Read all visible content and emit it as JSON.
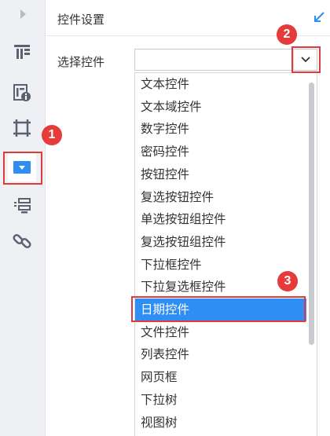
{
  "panel": {
    "title": "控件设置"
  },
  "field": {
    "label": "选择控件",
    "value": ""
  },
  "dropdown": {
    "options": [
      "文本控件",
      "文本域控件",
      "数字控件",
      "密码控件",
      "按钮控件",
      "复选按钮控件",
      "单选按钮组控件",
      "复选按钮组控件",
      "下拉框控件",
      "下拉复选框控件",
      "日期控件",
      "文件控件",
      "列表控件",
      "网页框",
      "下拉树",
      "视图树"
    ],
    "selected_index": 10
  },
  "rail": {
    "icons": [
      "collapse-arrow-icon",
      "form-layout-icon",
      "widget-info-icon",
      "canvas-crop-icon",
      "dropdown-widget-icon",
      "list-layout-icon",
      "link-icon"
    ],
    "active_index": 4
  },
  "badges": {
    "one": "1",
    "two": "2",
    "three": "3"
  },
  "colors": {
    "accent": "#2f8ef4",
    "highlight": "#e03b3b",
    "rail_bg": "#eef0f3"
  }
}
